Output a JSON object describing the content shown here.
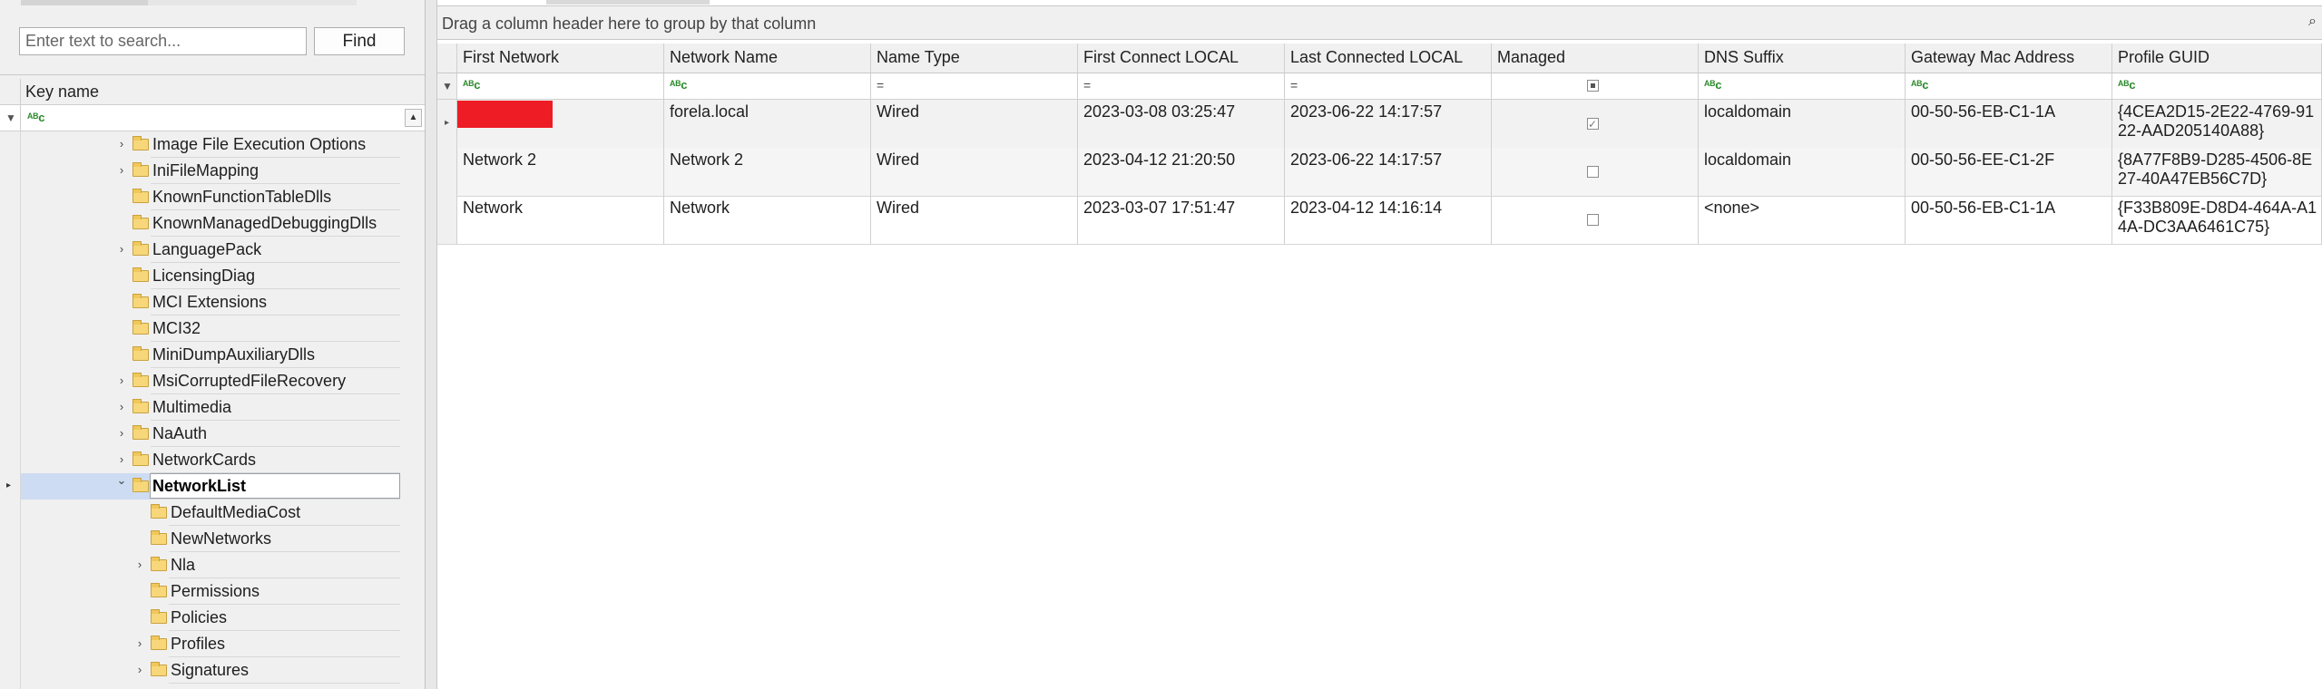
{
  "left_pane": {
    "search": {
      "placeholder": "Enter text to search...",
      "value": ""
    },
    "find_label": "Find",
    "tree_header": "Key name",
    "tree_items": [
      {
        "label": "Image File Execution Options",
        "level": 1,
        "expandable": true
      },
      {
        "label": "IniFileMapping",
        "level": 1,
        "expandable": true
      },
      {
        "label": "KnownFunctionTableDlls",
        "level": 1,
        "expandable": false
      },
      {
        "label": "KnownManagedDebuggingDlls",
        "level": 1,
        "expandable": false
      },
      {
        "label": "LanguagePack",
        "level": 1,
        "expandable": true
      },
      {
        "label": "LicensingDiag",
        "level": 1,
        "expandable": false
      },
      {
        "label": "MCI Extensions",
        "level": 1,
        "expandable": false
      },
      {
        "label": "MCI32",
        "level": 1,
        "expandable": false
      },
      {
        "label": "MiniDumpAuxiliaryDlls",
        "level": 1,
        "expandable": false
      },
      {
        "label": "MsiCorruptedFileRecovery",
        "level": 1,
        "expandable": true
      },
      {
        "label": "Multimedia",
        "level": 1,
        "expandable": true
      },
      {
        "label": "NaAuth",
        "level": 1,
        "expandable": true
      },
      {
        "label": "NetworkCards",
        "level": 1,
        "expandable": true
      },
      {
        "label": "NetworkList",
        "level": 1,
        "expandable": true,
        "expanded": true,
        "selected": true
      },
      {
        "label": "DefaultMediaCost",
        "level": 2,
        "expandable": false
      },
      {
        "label": "NewNetworks",
        "level": 2,
        "expandable": false
      },
      {
        "label": "Nla",
        "level": 2,
        "expandable": true
      },
      {
        "label": "Permissions",
        "level": 2,
        "expandable": false
      },
      {
        "label": "Policies",
        "level": 2,
        "expandable": false
      },
      {
        "label": "Profiles",
        "level": 2,
        "expandable": true
      },
      {
        "label": "Signatures",
        "level": 2,
        "expandable": true
      }
    ]
  },
  "right_pane": {
    "group_hint": "Drag a column header here to group by that column",
    "columns": [
      "First Network",
      "Network Name",
      "Name Type",
      "First Connect LOCAL",
      "Last Connected LOCAL",
      "Managed",
      "DNS Suffix",
      "Gateway Mac Address",
      "Profile GUID"
    ],
    "rows": [
      {
        "first_network": "",
        "network_name": "forela.local",
        "name_type": "Wired",
        "first_connect": "2023-03-08 03:25:47",
        "last_connected": "2023-06-22 14:17:57",
        "managed": true,
        "dns_suffix": "localdomain",
        "gateway_mac": "00-50-56-EB-C1-1A",
        "profile_guid": "{4CEA2D15-2E22-4769-9122-AAD205140A88}",
        "profile_guid_lines": [
          "{4CEA2D15-2E22-4769-91",
          "22-AAD205140A88}"
        ]
      },
      {
        "first_network": "Network 2",
        "network_name": "Network 2",
        "name_type": "Wired",
        "first_connect": "2023-04-12 21:20:50",
        "last_connected": "2023-06-22 14:17:57",
        "managed": false,
        "dns_suffix": "localdomain",
        "gateway_mac": "00-50-56-EE-C1-2F",
        "profile_guid": "{8A77F8B9-D285-4506-8E27-40A47EB56C7D}",
        "profile_guid_lines": [
          "{8A77F8B9-D285-4506-8E",
          "27-40A47EB56C7D}"
        ]
      },
      {
        "first_network": "Network",
        "network_name": "Network",
        "name_type": "Wired",
        "first_connect": "2023-03-07 17:51:47",
        "last_connected": "2023-04-12 14:16:14",
        "managed": false,
        "dns_suffix": "<none>",
        "gateway_mac": "00-50-56-EB-C1-1A",
        "profile_guid": "{F33B809E-D8D4-464A-A14A-DC3AA6461C75}",
        "profile_guid_lines": [
          "{F33B809E-D8D4-464A-A1",
          "4A-DC3AA6461C75}"
        ]
      }
    ],
    "filter_ops": {
      "text": "ᴬᴮc",
      "equals": "="
    }
  },
  "icons": {
    "funnel": "filter-funnel-icon",
    "search": "magnifier-icon",
    "folder": "folder-icon",
    "chevron_right": "chevron-right-icon",
    "chevron_down": "chevron-down-icon"
  },
  "colors": {
    "selection": "#cddcf3",
    "redaction": "#ee1c25",
    "folder": "#f7d77a"
  }
}
